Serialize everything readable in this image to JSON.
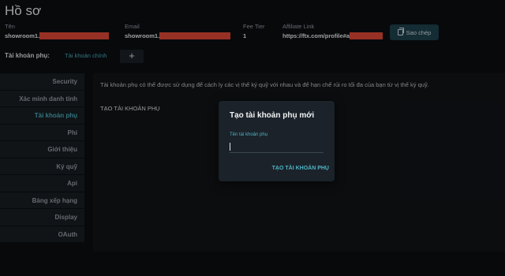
{
  "page": {
    "title": "Hồ sơ"
  },
  "profile": {
    "name_label": "Tên",
    "name_value": "showroom1.",
    "email_label": "Email",
    "email_value": "showroom1.",
    "fee_label": "Fee Tier",
    "fee_value": "1",
    "affiliate_label": "Affiliate Link",
    "affiliate_value": "https://ftx.com/profile#a",
    "copy_label": "Sao chép"
  },
  "subaccounts": {
    "label": "Tài khoản phụ:",
    "main_tab": "Tài khoản chính",
    "add_symbol": "+"
  },
  "sidebar": {
    "items": [
      {
        "label": "Security",
        "active": false
      },
      {
        "label": "Xác minh danh tính",
        "active": false
      },
      {
        "label": "Tài khoản phụ",
        "active": true
      },
      {
        "label": "Phí",
        "active": false
      },
      {
        "label": "Giới thiệu",
        "active": false
      },
      {
        "label": "Ký quỹ",
        "active": false
      },
      {
        "label": "Api",
        "active": false
      },
      {
        "label": "Bảng xếp hạng",
        "active": false
      },
      {
        "label": "Display",
        "active": false
      },
      {
        "label": "OAuth",
        "active": false
      }
    ]
  },
  "main": {
    "description": "Tài khoản phụ có thể được sử dụng để cách ly các vị thế ký quỹ với nhau và để hạn chế rủi ro tối đa của bạn từ vị thế ký quỹ.",
    "create_link": "TẠO TÀI KHOẢN PHỤ"
  },
  "dialog": {
    "title": "Tạo tài khoản phụ mới",
    "field_label": "Tên tài khoản phụ",
    "field_value": "",
    "action_label": "TẠO TÀI KHOẢN PHỤ"
  },
  "colors": {
    "accent": "#4fb3c4",
    "background": "#0b0e12",
    "redaction": "#e94b3a"
  }
}
